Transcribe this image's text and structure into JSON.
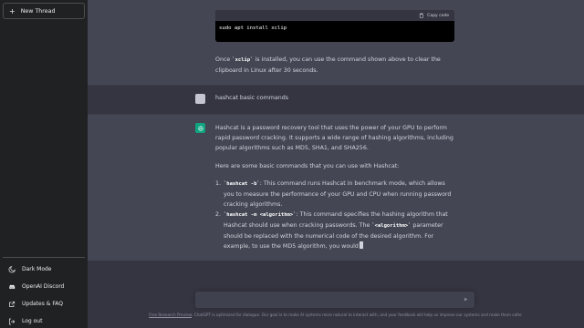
{
  "sidebar": {
    "new_thread_label": "New Thread",
    "bottom_items": [
      {
        "label": "Dark Mode",
        "icon": "moon-icon"
      },
      {
        "label": "OpenAI Discord",
        "icon": "discord-icon"
      },
      {
        "label": "Updates & FAQ",
        "icon": "external-link-icon"
      },
      {
        "label": "Log out",
        "icon": "logout-icon"
      }
    ]
  },
  "conversation": {
    "code_block": {
      "copy_label": "Copy code",
      "code": "sudo apt install xclip"
    },
    "prev_after_code": {
      "pre": "Once ",
      "code": "`xclip`",
      "post": " is installed, you can use the command shown above to clear the clipboard in Linux after 30 seconds."
    },
    "user_message": "hashcat basic commands",
    "response": {
      "intro": "Hashcat is a password recovery tool that uses the power of your GPU to perform rapid password cracking. It supports a wide range of hashing algorithms, including popular algorithms such as MD5, SHA1, and SHA256.",
      "lead": "Here are some basic commands that you can use with Hashcat:",
      "items": [
        {
          "bullet": "1.",
          "code": "`hashcat -b`",
          "text": ": This command runs Hashcat in benchmark mode, which allows you to measure the performance of your GPU and CPU when running password cracking algorithms."
        },
        {
          "bullet": "2.",
          "code": "`hashcat -m <algorithm>`",
          "text": ": This command specifies the hashing algorithm that Hashcat should use when cracking passwords. The ",
          "code2": "`<algorithm>`",
          "text2": " parameter should be replaced with the numerical code of the desired algorithm. For example, to use the MD5 algorithm, you would"
        }
      ]
    }
  },
  "footer": {
    "link": "Free Research Preview",
    "text": ": ChatGPT is optimized for dialogue. Our goal is to make AI systems more natural to interact with, and your feedback will help us improve our systems and make them safer."
  },
  "colors": {
    "sidebar_bg": "#202123",
    "main_bg": "#343541",
    "ai_block_bg": "#444654",
    "assistant_avatar": "#10a37f"
  }
}
